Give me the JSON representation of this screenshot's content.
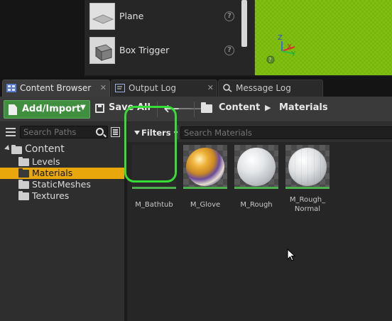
{
  "place_actors": {
    "items": [
      {
        "label": "Plane"
      },
      {
        "label": "Box Trigger"
      }
    ]
  },
  "viewport": {
    "axis_labels": {
      "z": "Z",
      "x": "X",
      "y": "Y"
    }
  },
  "tabs": [
    {
      "label": "Content Browser",
      "icon": "content-browser-icon",
      "active": true
    },
    {
      "label": "Output Log",
      "icon": "output-log-icon",
      "active": false
    },
    {
      "label": "Message Log",
      "icon": "message-log-icon",
      "active": false
    }
  ],
  "toolbar": {
    "add_import_label": "Add/Import",
    "save_all_label": "Save All",
    "breadcrumbs": [
      "Content",
      "Materials"
    ],
    "accent_color": "#3f8f3f"
  },
  "sources": {
    "search_placeholder": "Search Paths",
    "tree": [
      {
        "label": "Content",
        "level": 0,
        "expanded": true,
        "selected": false
      },
      {
        "label": "Levels",
        "level": 1,
        "selected": false
      },
      {
        "label": "Materials",
        "level": 1,
        "selected": true
      },
      {
        "label": "StaticMeshes",
        "level": 1,
        "selected": false
      },
      {
        "label": "Textures",
        "level": 1,
        "selected": false
      }
    ],
    "selection_color": "#e8a80c"
  },
  "assets": {
    "filters_label": "Filters",
    "search_placeholder": "Search Materials",
    "items": [
      {
        "name": "M_Bathtub",
        "highlighted": true
      },
      {
        "name": "M_Glove"
      },
      {
        "name": "M_Rough"
      },
      {
        "name_line1": "M_Rough_",
        "name_line2": "Normal"
      }
    ],
    "highlight_color": "#35dd35"
  }
}
